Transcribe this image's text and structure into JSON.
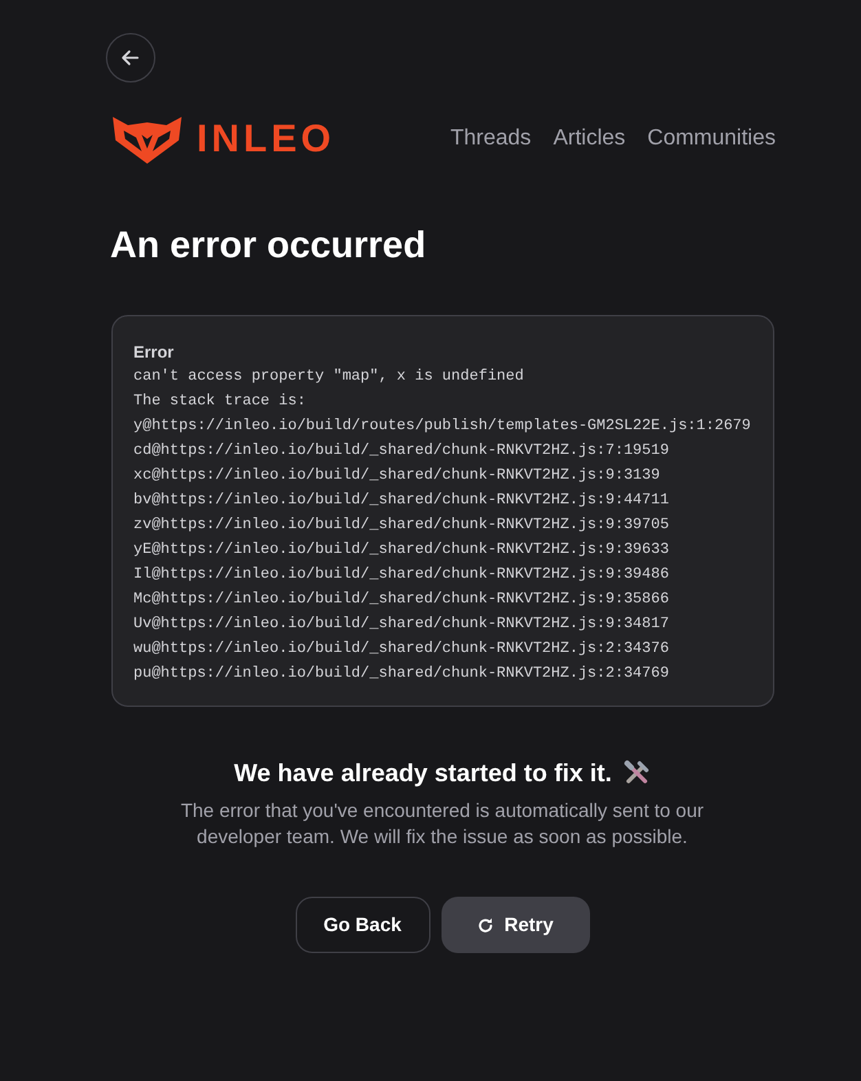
{
  "back_button": {
    "kind": "arrow"
  },
  "logo": {
    "text": "INLEO"
  },
  "nav": [
    "Threads",
    "Articles",
    "Communities"
  ],
  "title": "An error occurred",
  "error_box": {
    "label": "Error",
    "lines": [
      "can't access property \"map\", x is undefined",
      "The stack trace is:",
      "y@https://inleo.io/build/routes/publish/templates-GM2SL22E.js:1:2679",
      "cd@https://inleo.io/build/_shared/chunk-RNKVT2HZ.js:7:19519",
      "xc@https://inleo.io/build/_shared/chunk-RNKVT2HZ.js:9:3139",
      "bv@https://inleo.io/build/_shared/chunk-RNKVT2HZ.js:9:44711",
      "zv@https://inleo.io/build/_shared/chunk-RNKVT2HZ.js:9:39705",
      "yE@https://inleo.io/build/_shared/chunk-RNKVT2HZ.js:9:39633",
      "Il@https://inleo.io/build/_shared/chunk-RNKVT2HZ.js:9:39486",
      "Mc@https://inleo.io/build/_shared/chunk-RNKVT2HZ.js:9:35866",
      "Uv@https://inleo.io/build/_shared/chunk-RNKVT2HZ.js:9:34817",
      "wu@https://inleo.io/build/_shared/chunk-RNKVT2HZ.js:2:34376",
      "pu@https://inleo.io/build/_shared/chunk-RNKVT2HZ.js:2:34769"
    ]
  },
  "message": {
    "heading": "We have already started to fix it.",
    "body": "The error that you've encountered is automatically sent to our developer team. We will fix the issue as soon as possible."
  },
  "buttons": [
    {
      "label": "Go Back",
      "kind": "outline"
    },
    {
      "label": "Retry",
      "kind": "retry"
    }
  ]
}
